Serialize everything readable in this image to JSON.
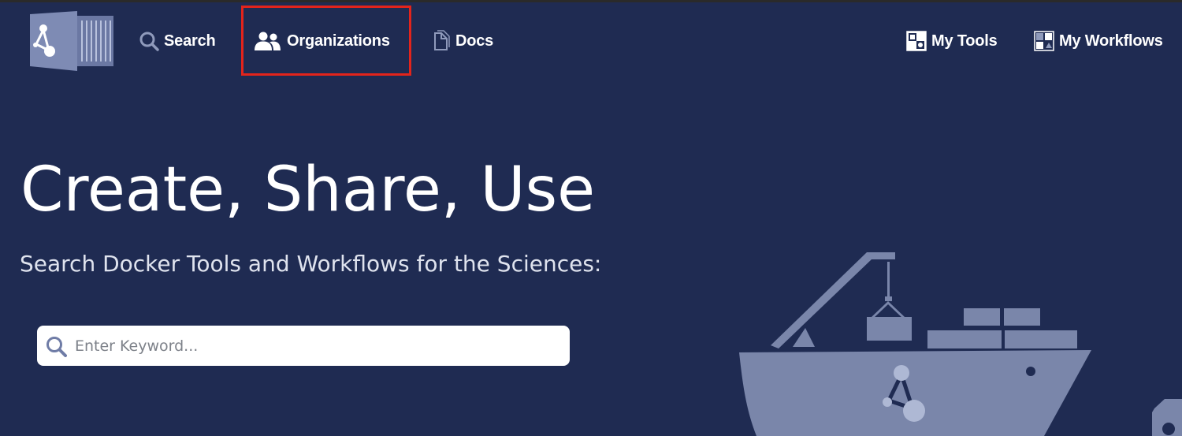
{
  "nav": {
    "search_label": "Search",
    "organizations_label": "Organizations",
    "docs_label": "Docs",
    "my_tools_label": "My Tools",
    "my_workflows_label": "My Workflows"
  },
  "hero": {
    "title": "Create, Share, Use",
    "subtitle": "Search Docker Tools and Workflows for the Sciences:"
  },
  "search": {
    "placeholder": "Enter Keyword..."
  },
  "colors": {
    "background": "#1f2b52",
    "highlight": "#e3241b",
    "illustration": "#7a86aa"
  },
  "icons": {
    "logo": "container-logo",
    "search": "search-icon",
    "organizations": "people-icon",
    "docs": "document-icon",
    "my_tools": "tools-icon",
    "my_workflows": "workflows-icon"
  }
}
